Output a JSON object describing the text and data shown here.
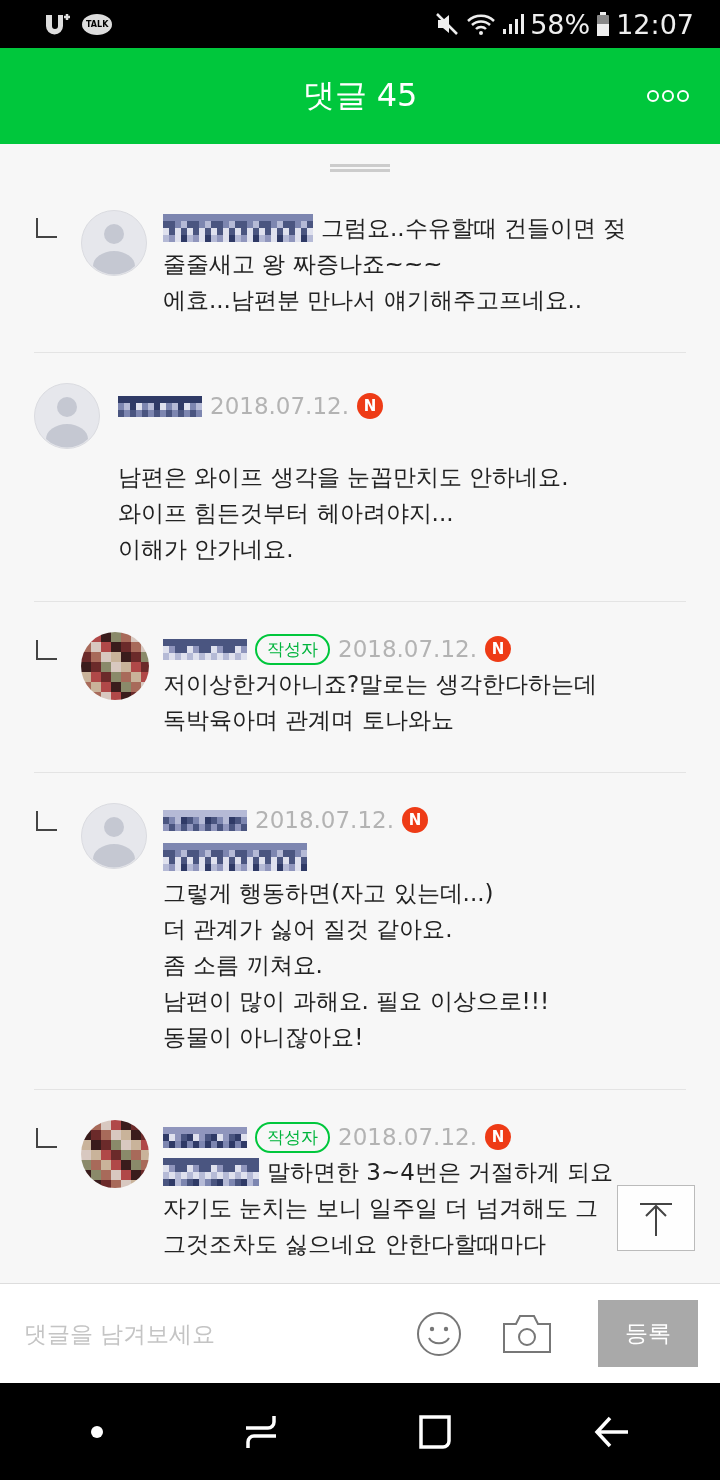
{
  "status_bar": {
    "talk_label": "TALK",
    "battery": "58%",
    "time": "12:07"
  },
  "header": {
    "title": "댓글 45"
  },
  "comments": [
    {
      "reply": true,
      "avatar": {
        "kind": "default"
      },
      "mention": {
        "kind": "mosaic",
        "own_line": false
      },
      "text": "그럼요..수유할때 건들이면 젖\n줄줄새고 왕 짜증나죠~~~\n에효...남편분 만나서 얘기해주고프네요.."
    },
    {
      "reply": false,
      "avatar": {
        "kind": "default"
      },
      "author": {
        "kind": "mosaic"
      },
      "date": "2018.07.12.",
      "new_badge": "N",
      "text": "남편은 와이프 생각을 눈꼽만치도 안하네요.\n와이프 힘든것부터 헤아려야지...\n이해가 안가네요."
    },
    {
      "reply": true,
      "author": {
        "kind": "mosaic"
      },
      "writer_badge": "작성자",
      "date": "2018.07.12.",
      "new_badge": "N",
      "text": "저이상한거아니죠?말로는 생각한다하는데\n독박육아며 관계며 토나와뇨"
    },
    {
      "reply": true,
      "avatar": {
        "kind": "default"
      },
      "author": {
        "kind": "mosaic"
      },
      "date": "2018.07.12.",
      "new_badge": "N",
      "mention": {
        "kind": "mosaic",
        "own_line": true
      },
      "text": "그렇게 행동하면(자고 있는데...)\n더 관계가 싫어 질것 같아요.\n좀 소름 끼쳐요.\n남편이 많이 과해요. 필요 이상으로!!!\n동물이 아니잖아요!"
    },
    {
      "reply": true,
      "author": {
        "kind": "mosaic"
      },
      "writer_badge": "작성자",
      "date": "2018.07.12.",
      "new_badge": "N",
      "mention": {
        "kind": "mosaic",
        "own_line": false
      },
      "text": "말하면한 3~4번은 거절하게 되요\n자기도 눈치는 보니 일주일 더 넘겨해도 그\n그것조차도 싫으네요 안한다할때마다"
    }
  ],
  "comment_input": {
    "placeholder": "댓글을 남겨보세요",
    "submit": "등록",
    "disabled": true
  }
}
